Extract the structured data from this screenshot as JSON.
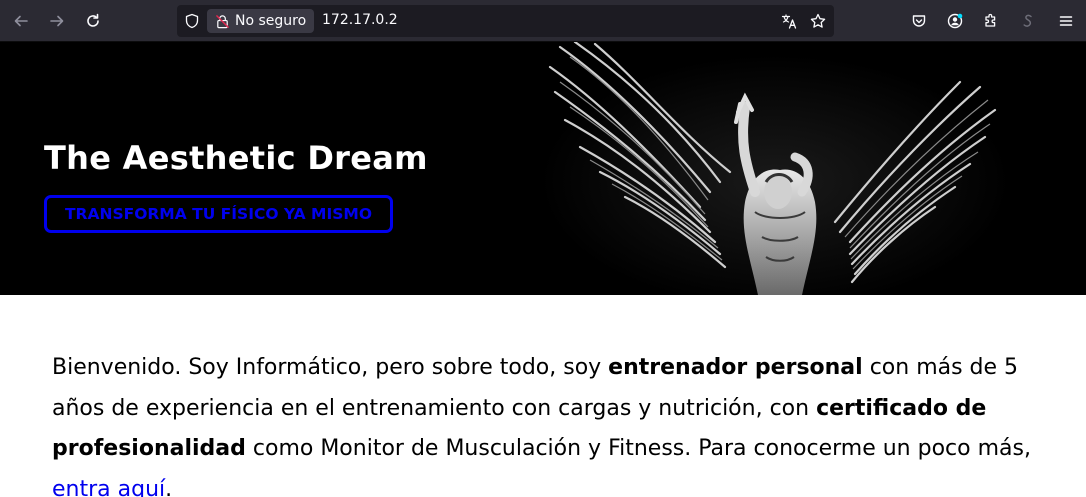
{
  "browser": {
    "security_label": "No seguro",
    "url": "172.17.0.2",
    "icons": [
      "back-icon",
      "forward-icon",
      "reload-icon",
      "shield-icon",
      "insecure-lock-icon",
      "translate-icon",
      "bookmark-star-icon",
      "pocket-icon",
      "account-icon",
      "extensions-icon",
      "sync-icon",
      "menu-icon"
    ],
    "colors": {
      "toolbar": "#2b2a33",
      "urlbar": "#1c1b22",
      "text": "#fbfbfe"
    }
  },
  "hero": {
    "title": "The Aesthetic Dream",
    "cta_label": "TRANSFORMA TU FÍSICO YA MISMO",
    "image": "winged-figure-illustration",
    "colors": {
      "background": "#000000",
      "accent": "#0000ee"
    }
  },
  "intro": {
    "part1": "Bienvenido. Soy Informático, pero sobre todo, soy ",
    "bold1": "entrenador personal",
    "part2": " con más de 5 años de experiencia en el entrenamiento con cargas y nutrición, con ",
    "bold2": "certificado de profesionalidad",
    "part3": " como Monitor de Musculación y Fitness. Para conocerme un poco más, ",
    "link_text": "entra aquí",
    "part4": "."
  }
}
